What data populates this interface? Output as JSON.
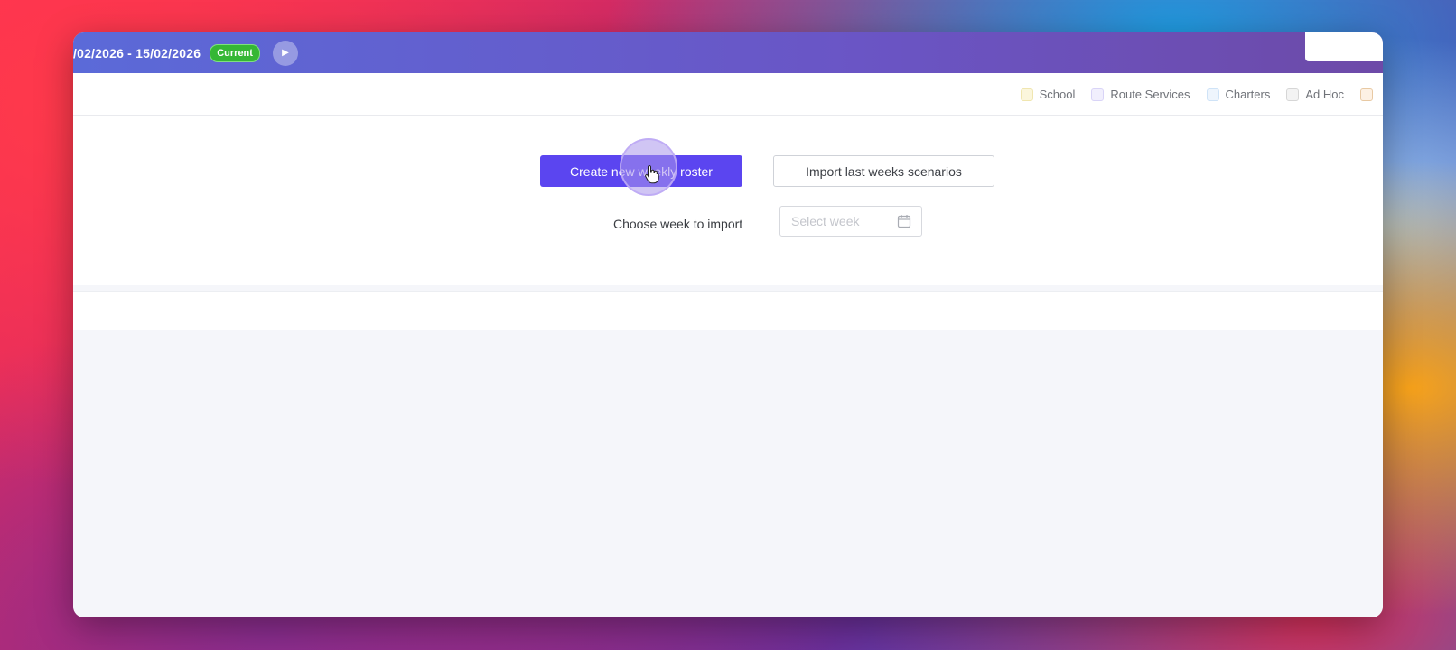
{
  "header": {
    "date_range": "/02/2026 - 15/02/2026",
    "current_badge": "Current",
    "next_icon": "caret-right-icon"
  },
  "legend": [
    {
      "label": "School",
      "color": "#f2e8a8"
    },
    {
      "label": "Route Services",
      "color": "#d9d4f7"
    },
    {
      "label": "Charters",
      "color": "#cfe3f7"
    },
    {
      "label": "Ad Hoc",
      "color": "#dcdcdc"
    },
    {
      "label": "",
      "color": "#f5d9b8"
    }
  ],
  "actions": {
    "create_label": "Create new weekly roster",
    "import_label": "Import last weeks scenarios",
    "choose_week_label": "Choose week to import",
    "week_placeholder": "Select week"
  },
  "colors": {
    "accent": "#5b45f0",
    "badge": "#35b735"
  }
}
